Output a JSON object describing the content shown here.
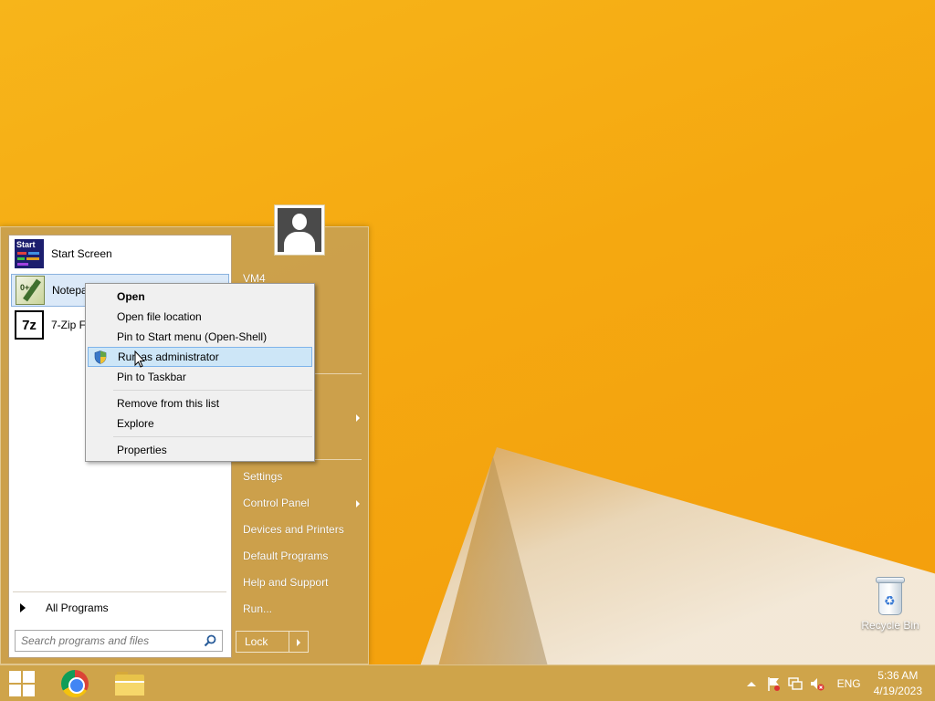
{
  "desktop": {
    "recycle_bin_label": "Recycle Bin"
  },
  "start_menu": {
    "programs": [
      {
        "label": "Start Screen",
        "icon": "start-screen-icon"
      },
      {
        "label": "Notepad",
        "icon": "notepad-plus-plus-icon"
      },
      {
        "label": "7-Zip Fil",
        "icon": "7zip-icon"
      }
    ],
    "all_programs_label": "All Programs",
    "search_placeholder": "Search programs and files",
    "user_name": "VM4",
    "right_items": {
      "settings": "Settings",
      "control_panel": "Control Panel",
      "devices": "Devices and Printers",
      "default_programs": "Default Programs",
      "help": "Help and Support",
      "run": "Run..."
    },
    "lock_label": "Lock"
  },
  "context_menu": {
    "items": [
      {
        "label": "Open",
        "bold": true
      },
      {
        "label": "Open file location"
      },
      {
        "label": "Pin to Start menu (Open-Shell)"
      },
      {
        "label": "Run as administrator",
        "highlighted": true
      },
      {
        "label": "Pin to Taskbar"
      },
      {
        "label": "Remove from this list"
      },
      {
        "label": "Explore"
      },
      {
        "label": "Properties"
      }
    ]
  },
  "taskbar": {
    "apps": [
      "windows-start-icon",
      "chrome-icon",
      "file-explorer-icon"
    ],
    "language": "ENG",
    "time": "5:36 AM",
    "date": "4/19/2023"
  },
  "colors": {
    "accent": "#c8a050",
    "highlight": "#cde6f7"
  }
}
